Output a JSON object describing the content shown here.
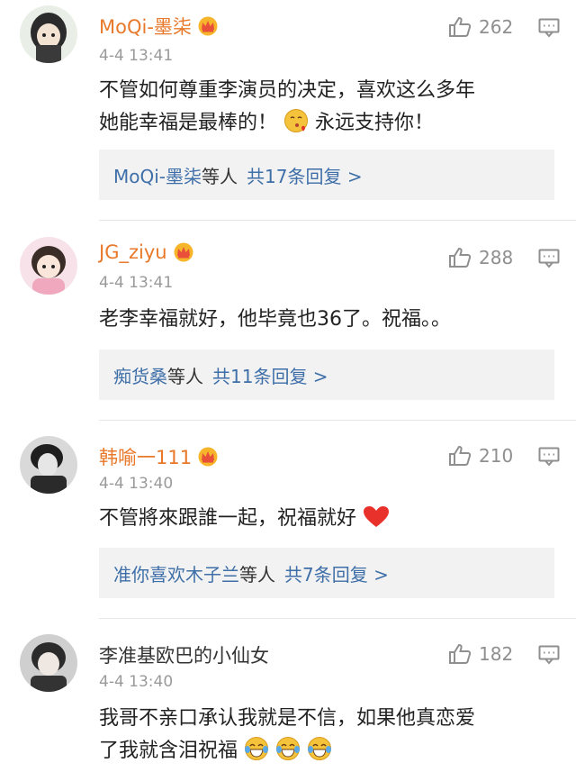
{
  "comments": [
    {
      "username": "MoQi-墨柒",
      "vip": true,
      "time": "4-4 13:41",
      "likes": "262",
      "text_line1": "不管如何尊重李演员的决定，喜欢这么多年",
      "text_line2_a": "她能幸福是最棒的！",
      "text_line2_b": "永远支持你！",
      "replies_who": "MoQi-墨柒",
      "replies_etc": "等人",
      "replies_count": "共17条回复 >"
    },
    {
      "username": "JG_ziyu",
      "vip": true,
      "time": "4-4 13:41",
      "likes": "288",
      "text": "老李幸福就好，他毕竟也36了。祝福。。",
      "replies_who": "痴货桑",
      "replies_etc": "等人",
      "replies_count": "共11条回复 >"
    },
    {
      "username": "韩喻一111",
      "vip": true,
      "time": "4-4 13:40",
      "likes": "210",
      "text": "不管將來跟誰一起，祝福就好",
      "replies_who": "准你喜欢木子兰",
      "replies_etc": "等人",
      "replies_count": "共7条回复 >"
    },
    {
      "username": "李准基欧巴的小仙女",
      "vip": false,
      "time": "4-4 13:40",
      "likes": "182",
      "text_line1": "我哥不亲口承认我就是不信，如果他真恋爱",
      "text_line2": "了我就含泪祝福"
    }
  ],
  "colors": {
    "vip_name": "#e8792a",
    "link": "#3f6fa8",
    "meta": "#9a9a9a",
    "reply_bg": "#f2f2f2"
  },
  "icons": {
    "like": "thumbs-up-icon",
    "reply": "comment-icon",
    "vip": "crown-icon"
  }
}
